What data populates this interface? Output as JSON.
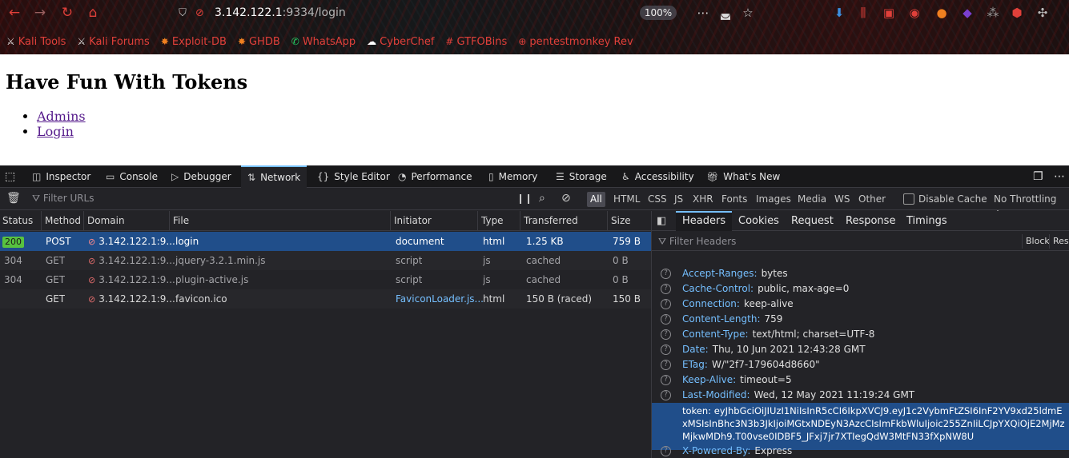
{
  "browser": {
    "url_host": "3.142.122.1",
    "url_path": ":9334/login",
    "zoom": "100%",
    "bookmarks": [
      {
        "label": "Kali Tools",
        "icon": "kali-dragon-icon"
      },
      {
        "label": "Kali Forums",
        "icon": "kali-dragon-icon"
      },
      {
        "label": "Exploit-DB",
        "icon": "exploitdb-icon"
      },
      {
        "label": "GHDB",
        "icon": "ghdb-icon"
      },
      {
        "label": "WhatsApp",
        "icon": "whatsapp-icon"
      },
      {
        "label": "CyberChef",
        "icon": "chef-hat-icon"
      },
      {
        "label": "GTFOBins",
        "icon": "hash-icon"
      },
      {
        "label": "pentestmonkey Rev",
        "icon": "globe-icon"
      }
    ]
  },
  "page": {
    "title": "Have Fun With Tokens",
    "links": [
      "Admins",
      "Login"
    ]
  },
  "devtools": {
    "tabs": [
      "Inspector",
      "Console",
      "Debugger",
      "Network",
      "Style Editor",
      "Performance",
      "Memory",
      "Storage",
      "Accessibility",
      "What's New"
    ],
    "active_tab": "Network",
    "filter_placeholder": "Filter URLs",
    "filter_types": [
      "All",
      "HTML",
      "CSS",
      "JS",
      "XHR",
      "Fonts",
      "Images",
      "Media",
      "WS",
      "Other"
    ],
    "disable_cache": "Disable Cache",
    "throttling": "No Throttling ↕",
    "columns": [
      "Status",
      "Method",
      "Domain",
      "File",
      "Initiator",
      "Type",
      "Transferred",
      "Size"
    ],
    "requests": [
      {
        "status": "200",
        "method": "POST",
        "domain": "3.142.122.1:9...",
        "file": "login",
        "initiator": "document",
        "type": "html",
        "transferred": "1.25 KB",
        "size": "759 B"
      },
      {
        "status": "304",
        "method": "GET",
        "domain": "3.142.122.1:9...",
        "file": "jquery-3.2.1.min.js",
        "initiator": "script",
        "type": "js",
        "transferred": "cached",
        "size": "0 B"
      },
      {
        "status": "304",
        "method": "GET",
        "domain": "3.142.122.1:9...",
        "file": "plugin-active.js",
        "initiator": "script",
        "type": "js",
        "transferred": "cached",
        "size": "0 B"
      },
      {
        "status": "",
        "method": "GET",
        "domain": "3.142.122.1:9...",
        "file": "favicon.ico",
        "initiator": "FaviconLoader.js...",
        "type": "html",
        "transferred": "150 B (raced)",
        "size": "150 B"
      }
    ],
    "panel_tabs": [
      "Headers",
      "Cookies",
      "Request",
      "Response",
      "Timings"
    ],
    "filter_headers_placeholder": "Filter Headers",
    "block_label": "Block",
    "rese_label": "Rese",
    "headers": [
      {
        "name": "Accept-Ranges:",
        "value": "bytes"
      },
      {
        "name": "Cache-Control:",
        "value": "public, max-age=0"
      },
      {
        "name": "Connection:",
        "value": "keep-alive"
      },
      {
        "name": "Content-Length:",
        "value": "759"
      },
      {
        "name": "Content-Type:",
        "value": "text/html; charset=UTF-8"
      },
      {
        "name": "Date:",
        "value": "Thu, 10 Jun 2021 12:43:28 GMT"
      },
      {
        "name": "ETag:",
        "value": "W/\"2f7-179604d8660\""
      },
      {
        "name": "Keep-Alive:",
        "value": "timeout=5"
      },
      {
        "name": "Last-Modified:",
        "value": "Wed, 12 May 2021 11:19:24 GMT"
      }
    ],
    "token_header": {
      "name": "token:",
      "value": "eyJhbGciOiJIUzI1NiIsInR5cCI6IkpXVCJ9.eyJ1c2VybmFtZSI6InF2YV9xd25ldmExMSIsInBhc3N3b3JkIjoiMGtxNDEyN3AzcCIsImFkbWluIjoic255ZnIiLCJpYXQiOjE2MjMzMjkwMDh9.T00vse0IDBF5_JFxj7jr7XTIegQdW3MtFN33fXpNW8U"
    },
    "powered_by": {
      "name": "X-Powered-By:",
      "value": "Express"
    }
  }
}
